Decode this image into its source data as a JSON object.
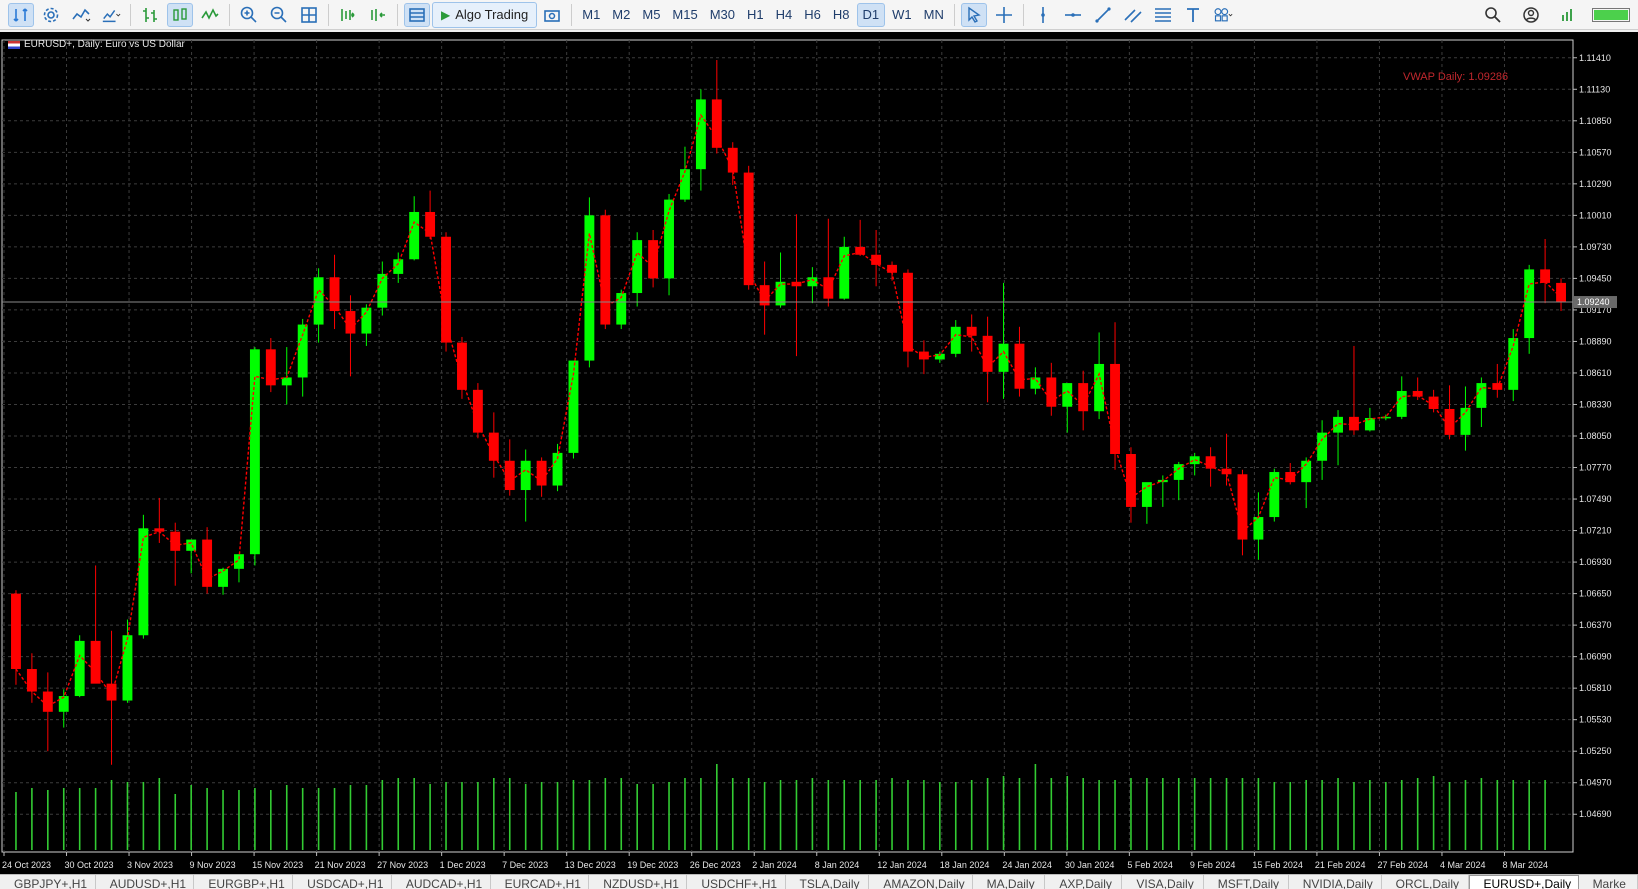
{
  "toolbar": {
    "algo_trading_label": "Algo Trading",
    "timeframes": [
      "M1",
      "M5",
      "M15",
      "M30",
      "H1",
      "H4",
      "H6",
      "H8",
      "D1",
      "W1",
      "MN"
    ],
    "timeframes_display": [
      "M1",
      "M2",
      "M5",
      "M15",
      "M30",
      "H1",
      "H4",
      "H6",
      "H8",
      "D1",
      "W1",
      "MN"
    ],
    "active_timeframe": "D1"
  },
  "chart": {
    "symbol_label": "EURUSD+, Daily:  Euro vs US Dollar",
    "vwap_label": "VWAP Daily: 1.09286",
    "current_price_label": "1.09240",
    "colors": {
      "bull": "#00ff00",
      "bear": "#ff0000",
      "grid": "#3c3c3c",
      "volume": "#33cc33",
      "vwap": "#ff0000",
      "bg": "#000000"
    }
  },
  "chart_data": {
    "type": "candlestick",
    "price_axis": {
      "range": [
        1.0455,
        1.1155
      ],
      "ticks": [
        "1.11410",
        "1.11130",
        "1.10850",
        "1.10570",
        "1.10290",
        "1.10010",
        "1.09730",
        "1.09450",
        "1.09170",
        "1.08890",
        "1.08610",
        "1.08330",
        "1.08050",
        "1.07770",
        "1.07490",
        "1.07210",
        "1.06930",
        "1.06650",
        "1.06370",
        "1.06090",
        "1.05810",
        "1.05530",
        "1.05250",
        "1.04970",
        "1.04690"
      ]
    },
    "date_labels": [
      "24 Oct 2023",
      "30 Oct 2023",
      "3 Nov 2023",
      "9 Nov 2023",
      "15 Nov 2023",
      "21 Nov 2023",
      "27 Nov 2023",
      "1 Dec 2023",
      "7 Dec 2023",
      "13 Dec 2023",
      "19 Dec 2023",
      "26 Dec 2023",
      "2 Jan 2024",
      "8 Jan 2024",
      "12 Jan 2024",
      "18 Jan 2024",
      "24 Jan 2024",
      "30 Jan 2024",
      "5 Feb 2024",
      "9 Feb 2024",
      "15 Feb 2024",
      "21 Feb 2024",
      "27 Feb 2024",
      "4 Mar 2024",
      "8 Mar 2024"
    ],
    "candles": [
      {
        "o": 1.0665,
        "h": 1.0668,
        "l": 1.0584,
        "c": 1.0598
      },
      {
        "o": 1.0598,
        "h": 1.0612,
        "l": 1.0568,
        "c": 1.0578
      },
      {
        "o": 1.0578,
        "h": 1.0595,
        "l": 1.0525,
        "c": 1.056
      },
      {
        "o": 1.056,
        "h": 1.058,
        "l": 1.0546,
        "c": 1.0574
      },
      {
        "o": 1.0574,
        "h": 1.0628,
        "l": 1.0573,
        "c": 1.0623
      },
      {
        "o": 1.0623,
        "h": 1.069,
        "l": 1.0596,
        "c": 1.0585
      },
      {
        "o": 1.0585,
        "h": 1.0632,
        "l": 1.0513,
        "c": 1.057
      },
      {
        "o": 1.057,
        "h": 1.0642,
        "l": 1.0568,
        "c": 1.0628
      },
      {
        "o": 1.0628,
        "h": 1.0735,
        "l": 1.0625,
        "c": 1.0723
      },
      {
        "o": 1.0723,
        "h": 1.075,
        "l": 1.071,
        "c": 1.072
      },
      {
        "o": 1.072,
        "h": 1.0728,
        "l": 1.0672,
        "c": 1.0703
      },
      {
        "o": 1.0703,
        "h": 1.0713,
        "l": 1.0683,
        "c": 1.0713
      },
      {
        "o": 1.0713,
        "h": 1.0724,
        "l": 1.0665,
        "c": 1.0671
      },
      {
        "o": 1.0671,
        "h": 1.0688,
        "l": 1.0664,
        "c": 1.0687
      },
      {
        "o": 1.0687,
        "h": 1.0693,
        "l": 1.0675,
        "c": 1.07
      },
      {
        "o": 1.07,
        "h": 1.0884,
        "l": 1.069,
        "c": 1.0882
      },
      {
        "o": 1.0882,
        "h": 1.0892,
        "l": 1.0844,
        "c": 1.085
      },
      {
        "o": 1.085,
        "h": 1.0884,
        "l": 1.0833,
        "c": 1.0857
      },
      {
        "o": 1.0857,
        "h": 1.0909,
        "l": 1.084,
        "c": 1.0904
      },
      {
        "o": 1.0904,
        "h": 1.0954,
        "l": 1.0888,
        "c": 1.0946
      },
      {
        "o": 1.0946,
        "h": 1.0966,
        "l": 1.09,
        "c": 1.0916
      },
      {
        "o": 1.0916,
        "h": 1.093,
        "l": 1.0858,
        "c": 1.0896
      },
      {
        "o": 1.0896,
        "h": 1.0922,
        "l": 1.0885,
        "c": 1.0919
      },
      {
        "o": 1.0919,
        "h": 1.096,
        "l": 1.0912,
        "c": 1.0949
      },
      {
        "o": 1.0949,
        "h": 1.0968,
        "l": 1.0941,
        "c": 1.0962
      },
      {
        "o": 1.0962,
        "h": 1.1018,
        "l": 1.0961,
        "c": 1.1004
      },
      {
        "o": 1.1004,
        "h": 1.1023,
        "l": 1.098,
        "c": 1.0982
      },
      {
        "o": 1.0982,
        "h": 1.0986,
        "l": 1.088,
        "c": 1.0888
      },
      {
        "o": 1.0888,
        "h": 1.0893,
        "l": 1.0838,
        "c": 1.0846
      },
      {
        "o": 1.0846,
        "h": 1.0852,
        "l": 1.0803,
        "c": 1.0808
      },
      {
        "o": 1.0808,
        "h": 1.0826,
        "l": 1.0768,
        "c": 1.0783
      },
      {
        "o": 1.0783,
        "h": 1.0802,
        "l": 1.0752,
        "c": 1.0757
      },
      {
        "o": 1.0757,
        "h": 1.0793,
        "l": 1.0729,
        "c": 1.0783
      },
      {
        "o": 1.0783,
        "h": 1.0786,
        "l": 1.0751,
        "c": 1.0761
      },
      {
        "o": 1.0761,
        "h": 1.0798,
        "l": 1.0756,
        "c": 1.079
      },
      {
        "o": 1.079,
        "h": 1.0865,
        "l": 1.0785,
        "c": 1.0872
      },
      {
        "o": 1.0872,
        "h": 1.1017,
        "l": 1.0866,
        "c": 1.1001
      },
      {
        "o": 1.1001,
        "h": 1.1006,
        "l": 1.09,
        "c": 1.0904
      },
      {
        "o": 1.0904,
        "h": 1.0935,
        "l": 1.09,
        "c": 1.0932
      },
      {
        "o": 1.0932,
        "h": 1.0986,
        "l": 1.092,
        "c": 1.0979
      },
      {
        "o": 1.0979,
        "h": 1.0988,
        "l": 1.0937,
        "c": 1.0945
      },
      {
        "o": 1.0945,
        "h": 1.102,
        "l": 1.093,
        "c": 1.1015
      },
      {
        "o": 1.1015,
        "h": 1.1062,
        "l": 1.1013,
        "c": 1.1042
      },
      {
        "o": 1.1042,
        "h": 1.1113,
        "l": 1.1023,
        "c": 1.1104
      },
      {
        "o": 1.1104,
        "h": 1.1139,
        "l": 1.1056,
        "c": 1.1061
      },
      {
        "o": 1.1061,
        "h": 1.1066,
        "l": 1.1028,
        "c": 1.1039
      },
      {
        "o": 1.1039,
        "h": 1.1045,
        "l": 1.0935,
        "c": 1.0939
      },
      {
        "o": 1.0939,
        "h": 1.096,
        "l": 1.0895,
        "c": 1.0921
      },
      {
        "o": 1.0921,
        "h": 1.0968,
        "l": 1.0919,
        "c": 1.0942
      },
      {
        "o": 1.0942,
        "h": 1.1002,
        "l": 1.0876,
        "c": 1.0938
      },
      {
        "o": 1.0938,
        "h": 1.0955,
        "l": 1.0923,
        "c": 1.0946
      },
      {
        "o": 1.0946,
        "h": 1.0998,
        "l": 1.092,
        "c": 1.0927
      },
      {
        "o": 1.0927,
        "h": 1.0982,
        "l": 1.0926,
        "c": 1.0973
      },
      {
        "o": 1.0973,
        "h": 1.0997,
        "l": 1.0965,
        "c": 1.0966
      },
      {
        "o": 1.0966,
        "h": 1.0988,
        "l": 1.0938,
        "c": 1.0957
      },
      {
        "o": 1.0957,
        "h": 1.096,
        "l": 1.0943,
        "c": 1.095
      },
      {
        "o": 1.095,
        "h": 1.0953,
        "l": 1.0866,
        "c": 1.088
      },
      {
        "o": 1.088,
        "h": 1.089,
        "l": 1.086,
        "c": 1.0873
      },
      {
        "o": 1.0873,
        "h": 1.088,
        "l": 1.087,
        "c": 1.0878
      },
      {
        "o": 1.0878,
        "h": 1.0908,
        "l": 1.0875,
        "c": 1.0902
      },
      {
        "o": 1.0902,
        "h": 1.0913,
        "l": 1.088,
        "c": 1.0894
      },
      {
        "o": 1.0894,
        "h": 1.0911,
        "l": 1.0835,
        "c": 1.0862
      },
      {
        "o": 1.0862,
        "h": 1.0941,
        "l": 1.0838,
        "c": 1.0887
      },
      {
        "o": 1.0887,
        "h": 1.0902,
        "l": 1.084,
        "c": 1.0847
      },
      {
        "o": 1.0847,
        "h": 1.0866,
        "l": 1.0842,
        "c": 1.0857
      },
      {
        "o": 1.0857,
        "h": 1.087,
        "l": 1.0823,
        "c": 1.0831
      },
      {
        "o": 1.0831,
        "h": 1.0851,
        "l": 1.0808,
        "c": 1.0852
      },
      {
        "o": 1.0852,
        "h": 1.0863,
        "l": 1.081,
        "c": 1.0827
      },
      {
        "o": 1.0827,
        "h": 1.0897,
        "l": 1.082,
        "c": 1.0869
      },
      {
        "o": 1.0869,
        "h": 1.0906,
        "l": 1.0775,
        "c": 1.0789
      },
      {
        "o": 1.0789,
        "h": 1.0795,
        "l": 1.0728,
        "c": 1.0742
      },
      {
        "o": 1.0742,
        "h": 1.0762,
        "l": 1.0727,
        "c": 1.0764
      },
      {
        "o": 1.0764,
        "h": 1.077,
        "l": 1.0742,
        "c": 1.0766
      },
      {
        "o": 1.0766,
        "h": 1.0782,
        "l": 1.0748,
        "c": 1.078
      },
      {
        "o": 1.078,
        "h": 1.079,
        "l": 1.077,
        "c": 1.0787
      },
      {
        "o": 1.0787,
        "h": 1.0795,
        "l": 1.076,
        "c": 1.0776
      },
      {
        "o": 1.0776,
        "h": 1.0807,
        "l": 1.0761,
        "c": 1.0771
      },
      {
        "o": 1.0771,
        "h": 1.0775,
        "l": 1.0699,
        "c": 1.0713
      },
      {
        "o": 1.0713,
        "h": 1.0755,
        "l": 1.0695,
        "c": 1.0733
      },
      {
        "o": 1.0733,
        "h": 1.0776,
        "l": 1.0729,
        "c": 1.0773
      },
      {
        "o": 1.0773,
        "h": 1.0781,
        "l": 1.0762,
        "c": 1.0764
      },
      {
        "o": 1.0764,
        "h": 1.0786,
        "l": 1.0741,
        "c": 1.0783
      },
      {
        "o": 1.0783,
        "h": 1.0819,
        "l": 1.0766,
        "c": 1.0808
      },
      {
        "o": 1.0808,
        "h": 1.0828,
        "l": 1.0779,
        "c": 1.0822
      },
      {
        "o": 1.0822,
        "h": 1.0885,
        "l": 1.0806,
        "c": 1.081
      },
      {
        "o": 1.081,
        "h": 1.083,
        "l": 1.0809,
        "c": 1.0821
      },
      {
        "o": 1.0821,
        "h": 1.0824,
        "l": 1.0819,
        "c": 1.0822
      },
      {
        "o": 1.0822,
        "h": 1.0858,
        "l": 1.082,
        "c": 1.0845
      },
      {
        "o": 1.0845,
        "h": 1.0857,
        "l": 1.0837,
        "c": 1.084
      },
      {
        "o": 1.084,
        "h": 1.0846,
        "l": 1.0826,
        "c": 1.0829
      },
      {
        "o": 1.0829,
        "h": 1.085,
        "l": 1.0802,
        "c": 1.0806
      },
      {
        "o": 1.0806,
        "h": 1.0849,
        "l": 1.0792,
        "c": 1.083
      },
      {
        "o": 1.083,
        "h": 1.0857,
        "l": 1.0813,
        "c": 1.0852
      },
      {
        "o": 1.0852,
        "h": 1.0869,
        "l": 1.0839,
        "c": 1.0846
      },
      {
        "o": 1.0846,
        "h": 1.09,
        "l": 1.0836,
        "c": 1.0892
      },
      {
        "o": 1.0892,
        "h": 1.0957,
        "l": 1.0878,
        "c": 1.0953
      },
      {
        "o": 1.0953,
        "h": 1.098,
        "l": 1.0923,
        "c": 1.0941
      },
      {
        "o": 1.0941,
        "h": 1.0945,
        "l": 1.0916,
        "c": 1.0924
      }
    ],
    "volumes": [
      0.58,
      0.62,
      0.6,
      0.62,
      0.62,
      0.62,
      0.7,
      0.68,
      0.68,
      0.72,
      0.56,
      0.65,
      0.62,
      0.6,
      0.6,
      0.62,
      0.6,
      0.65,
      0.62,
      0.62,
      0.62,
      0.65,
      0.65,
      0.7,
      0.72,
      0.72,
      0.66,
      0.68,
      0.68,
      0.68,
      0.72,
      0.72,
      0.66,
      0.68,
      0.68,
      0.7,
      0.7,
      0.72,
      0.72,
      0.66,
      0.66,
      0.68,
      0.72,
      0.72,
      0.86,
      0.72,
      0.72,
      0.68,
      0.7,
      0.7,
      0.72,
      0.7,
      0.7,
      0.7,
      0.7,
      0.72,
      0.7,
      0.7,
      0.68,
      0.68,
      0.7,
      0.72,
      0.74,
      0.72,
      0.86,
      0.72,
      0.74,
      0.72,
      0.7,
      0.7,
      0.72,
      0.72,
      0.72,
      0.72,
      0.72,
      0.72,
      0.72,
      0.72,
      0.72,
      0.68,
      0.68,
      0.7,
      0.7,
      0.72,
      0.68,
      0.7,
      0.68,
      0.7,
      0.72,
      0.74,
      0.68,
      0.7,
      0.72,
      0.7,
      0.7,
      0.7,
      0.7
    ],
    "vwap": [
      1.0598,
      1.0578,
      1.0565,
      1.0573,
      1.061,
      1.0595,
      1.0575,
      1.0625,
      1.0715,
      1.072,
      1.0708,
      1.071,
      1.0678,
      1.0685,
      1.0695,
      1.0858,
      1.0855,
      1.0857,
      1.0895,
      1.0935,
      1.092,
      1.09,
      1.0915,
      1.0945,
      1.0958,
      1.0995,
      1.0985,
      1.0905,
      1.0855,
      1.0815,
      1.0788,
      1.0765,
      1.0775,
      1.0765,
      1.0785,
      1.086,
      1.0985,
      1.092,
      1.0928,
      1.0968,
      1.0955,
      1.1005,
      1.104,
      1.109,
      1.107,
      1.1042,
      1.095,
      1.0925,
      1.094,
      1.094,
      1.0944,
      1.0935,
      1.0965,
      1.0968,
      1.0958,
      1.095,
      1.0885,
      1.0875,
      1.0877,
      1.0895,
      1.0893,
      1.0866,
      1.088,
      1.0855,
      1.0856,
      1.0836,
      1.0845,
      1.0832,
      1.086,
      1.0795,
      1.075,
      1.076,
      1.0765,
      1.0776,
      1.0784,
      1.0778,
      1.0772,
      1.072,
      1.0733,
      1.0768,
      1.0766,
      1.078,
      1.0802,
      1.0816,
      1.0815,
      1.082,
      1.0822,
      1.084,
      1.0841,
      1.0832,
      1.0812,
      1.0826,
      1.0848,
      1.0847,
      1.0885,
      1.094,
      1.0942,
      1.0928
    ]
  },
  "tabs": {
    "items": [
      "GBPJPY+,H1",
      "AUDUSD+,H1",
      "EURGBP+,H1",
      "USDCAD+,H1",
      "AUDCAD+,H1",
      "EURCAD+,H1",
      "NZDUSD+,H1",
      "USDCHF+,H1",
      "TSLA,Daily",
      "AMAZON,Daily",
      "MA,Daily",
      "AXP,Daily",
      "VISA,Daily",
      "MSFT,Daily",
      "NVIDIA,Daily",
      "ORCL,Daily",
      "EURUSD+,Daily",
      "Marke"
    ],
    "active_index": 16
  }
}
